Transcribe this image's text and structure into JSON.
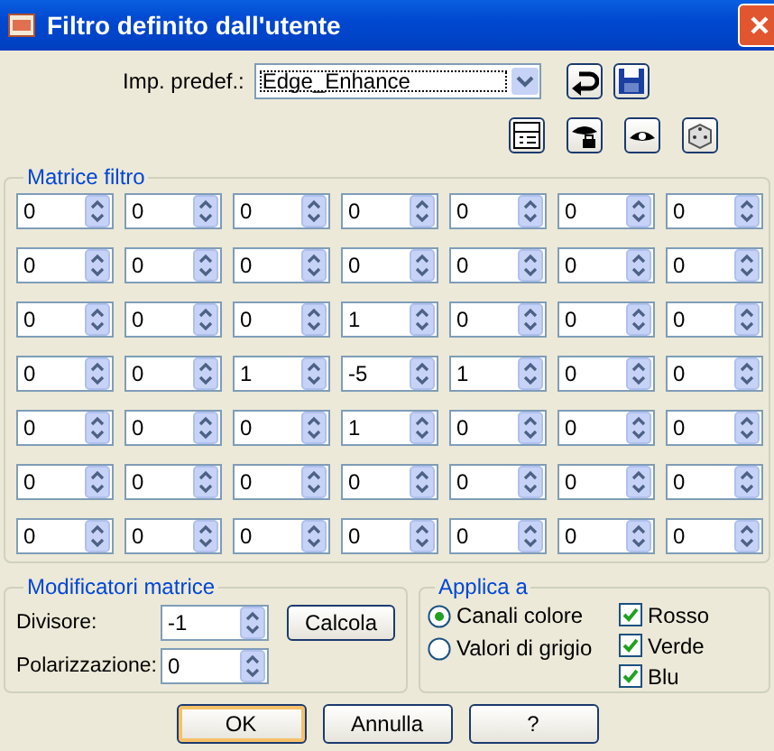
{
  "window": {
    "title": "Filtro definito dall'utente"
  },
  "preset": {
    "label": "Imp. predef.:",
    "value": "Edge_Enhance"
  },
  "matrix": {
    "title": "Matrice filtro",
    "rows": [
      [
        "0",
        "0",
        "0",
        "0",
        "0",
        "0",
        "0"
      ],
      [
        "0",
        "0",
        "0",
        "0",
        "0",
        "0",
        "0"
      ],
      [
        "0",
        "0",
        "0",
        "1",
        "0",
        "0",
        "0"
      ],
      [
        "0",
        "0",
        "1",
        "-5",
        "1",
        "0",
        "0"
      ],
      [
        "0",
        "0",
        "0",
        "1",
        "0",
        "0",
        "0"
      ],
      [
        "0",
        "0",
        "0",
        "0",
        "0",
        "0",
        "0"
      ],
      [
        "0",
        "0",
        "0",
        "0",
        "0",
        "0",
        "0"
      ]
    ]
  },
  "modifiers": {
    "title": "Modificatori matrice",
    "fields": [
      {
        "label": "Divisore:",
        "value": "-1"
      },
      {
        "label": "Polarizzazione:",
        "value": "0"
      }
    ],
    "button": "Calcola"
  },
  "apply": {
    "title": "Applica a",
    "radios": [
      {
        "label": "Canali colore",
        "selected": true
      },
      {
        "label": "Valori di grigio",
        "selected": false
      }
    ],
    "checks": [
      {
        "label": "Rosso",
        "checked": true
      },
      {
        "label": "Verde",
        "checked": true
      },
      {
        "label": "Blu",
        "checked": true
      }
    ]
  },
  "buttons": [
    {
      "label": "OK",
      "kind": "default"
    },
    {
      "label": "Annulla",
      "kind": "normal"
    },
    {
      "label": "?",
      "kind": "normal"
    }
  ]
}
